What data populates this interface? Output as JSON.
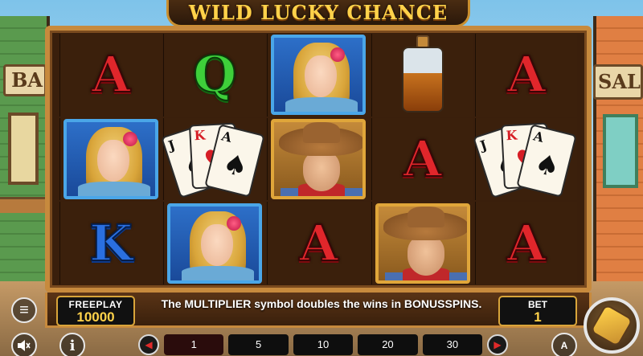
{
  "game": {
    "title": "WILD LUCKY CHANCE"
  },
  "background": {
    "left_sign": "BA",
    "right_sign": "SALO"
  },
  "reels": [
    [
      "A",
      "lady",
      "K"
    ],
    [
      "Q",
      "cards",
      "lady"
    ],
    [
      "lady",
      "cowboy",
      "A"
    ],
    [
      "bottle",
      "A",
      "cowboy"
    ],
    [
      "A",
      "cards",
      "A"
    ]
  ],
  "cards": {
    "ranks": [
      "J",
      "K",
      "A"
    ],
    "suits": [
      "♠",
      "♥",
      "♠"
    ]
  },
  "freeplay": {
    "label": "FREEPLAY",
    "value": "10000"
  },
  "bet": {
    "label": "BET",
    "value": "1"
  },
  "message": "The MULTIPLIER symbol doubles the wins in BONUSSPINS.",
  "bet_options": [
    "1",
    "5",
    "10",
    "20",
    "30"
  ],
  "bet_selected_index": 0,
  "icons": {
    "menu": "≡",
    "sound": "🔈",
    "info": "i",
    "auto": "A",
    "arrow_left": "◀",
    "arrow_right": "▶"
  },
  "colors": {
    "accent_gold": "#ffd24a",
    "frame": "#c78a3d",
    "symbol_A": "#e0262b",
    "symbol_Q": "#3ecf3a",
    "symbol_K": "#2a6fe0"
  }
}
